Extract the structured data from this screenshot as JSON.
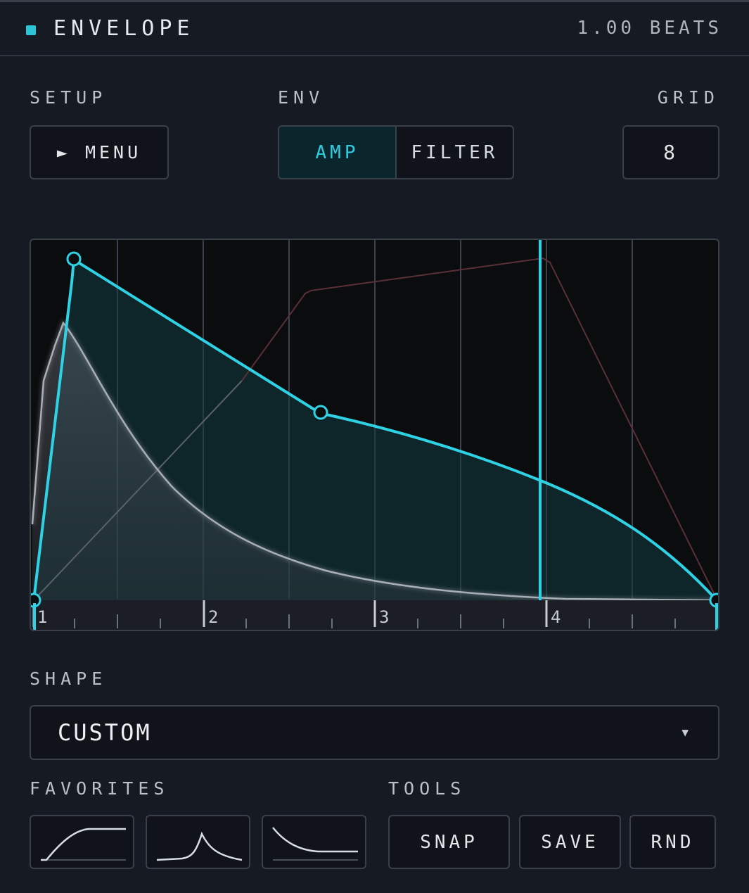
{
  "header": {
    "title": "ENVELOPE",
    "beats": "1.00 BEATS",
    "indicator_color": "#2ac6d8"
  },
  "setup": {
    "label": "SETUP",
    "menu_button": "► MENU"
  },
  "env": {
    "label": "ENV",
    "options": [
      "AMP",
      "FILTER"
    ],
    "selected": "AMP"
  },
  "grid": {
    "label": "GRID",
    "value": "8"
  },
  "graph": {
    "bar_labels": [
      "1",
      "2",
      "3",
      "4"
    ],
    "accent_color": "#2ac6d8",
    "playhead_beat": 3.95
  },
  "shape": {
    "label": "SHAPE",
    "selected": "CUSTOM"
  },
  "favorites": {
    "label": "FAVORITES",
    "items": [
      {
        "icon": "rise-curve-icon"
      },
      {
        "icon": "peak-curve-icon"
      },
      {
        "icon": "decay-curve-icon"
      }
    ]
  },
  "tools": {
    "label": "TOOLS",
    "buttons": [
      "SNAP",
      "SAVE",
      "RND"
    ]
  }
}
